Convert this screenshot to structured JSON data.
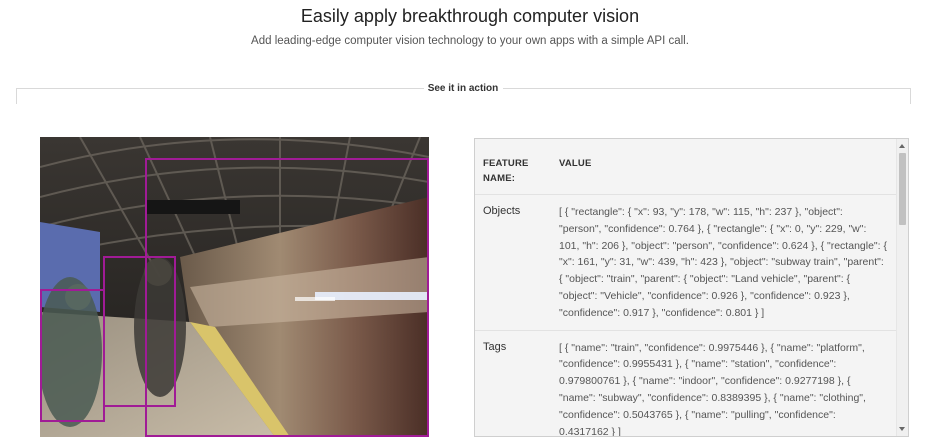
{
  "header": {
    "title": "Easily apply breakthrough computer vision",
    "subtitle": "Add leading-edge computer vision technology to your own apps with a simple API call."
  },
  "section": {
    "label": "See it in action"
  },
  "colors": {
    "bbox": "#a01b96"
  },
  "table": {
    "col_feature": "FEATURE NAME:",
    "col_value": "VALUE",
    "rows": [
      {
        "name": "Objects",
        "value": "[ { \"rectangle\": { \"x\": 93, \"y\": 178, \"w\": 115, \"h\": 237 }, \"object\": \"person\", \"confidence\": 0.764 }, { \"rectangle\": { \"x\": 0, \"y\": 229, \"w\": 101, \"h\": 206 }, \"object\": \"person\", \"confidence\": 0.624 }, { \"rectangle\": { \"x\": 161, \"y\": 31, \"w\": 439, \"h\": 423 }, \"object\": \"subway train\", \"parent\": { \"object\": \"train\", \"parent\": { \"object\": \"Land vehicle\", \"parent\": { \"object\": \"Vehicle\", \"confidence\": 0.926 }, \"confidence\": 0.923 }, \"confidence\": 0.917 }, \"confidence\": 0.801 } ]"
      },
      {
        "name": "Tags",
        "value": "[ { \"name\": \"train\", \"confidence\": 0.9975446 }, { \"name\": \"platform\", \"confidence\": 0.9955431 }, { \"name\": \"station\", \"confidence\": 0.979800761 }, { \"name\": \"indoor\", \"confidence\": 0.9277198 }, { \"name\": \"subway\", \"confidence\": 0.8389395 }, { \"name\": \"clothing\", \"confidence\": 0.5043765 }, { \"name\": \"pulling\", \"confidence\": 0.4317162 } ]"
      }
    ]
  }
}
